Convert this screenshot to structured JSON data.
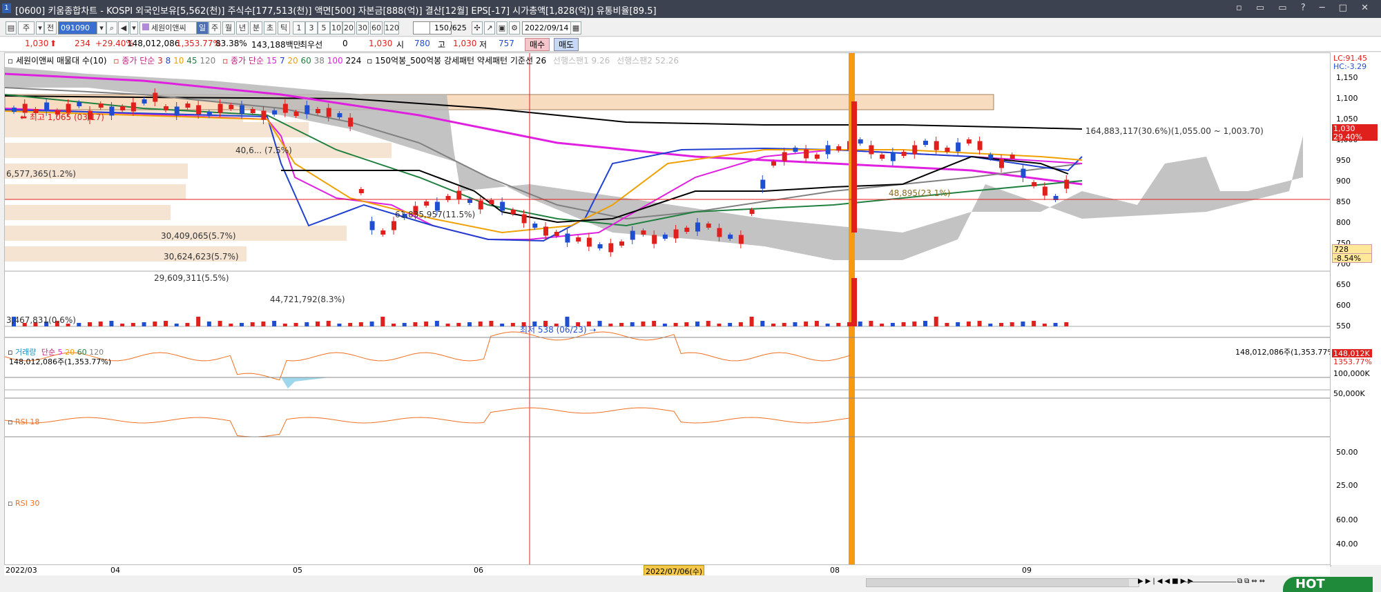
{
  "window": {
    "title": "[0600] 키움종합차트 - KOSPI 외국인보유[5,562(천)] 주식수[177,513(천)] 액면[500] 자본금[888(억)] 결산[12월] EPS[-17] 시가총액[1,828(억)] 유통비율[89.5]",
    "controls": [
      "minimize",
      "restore",
      "window",
      "help",
      "min",
      "max",
      "close"
    ]
  },
  "toolbar": {
    "period_ju": "주",
    "jeon": "전",
    "code": "091090",
    "stock_name": "세원이앤씨",
    "periods": [
      "일",
      "주",
      "월",
      "년",
      "분",
      "초",
      "틱"
    ],
    "active_period": "일",
    "intervals": [
      "1",
      "3",
      "5",
      "10",
      "20",
      "30",
      "60",
      "120"
    ],
    "count": "150",
    "total": "/625",
    "date": "2022/09/14"
  },
  "price_bar": {
    "price": "1,030",
    "change": "234",
    "change_pct": "+29.40%",
    "volume": "148,012,086",
    "vol_pct": "1,353.77%",
    "ratio": "83.38%",
    "amount": "143,188백만",
    "pref_label": "최우선",
    "pref_value": "0",
    "cur": "1,030",
    "open_label": "시",
    "open": "780",
    "high_label": "고",
    "high": "1,030",
    "low_label": "저",
    "low": "757",
    "buy": "매수",
    "sell": "매도"
  },
  "legend_price": {
    "name": "세원이앤씨 매물대 수(10)",
    "ma_label": "종가 단순",
    "ma_periods": [
      "3",
      "8",
      "10",
      "45",
      "120"
    ],
    "ma2_label": "종가 단순",
    "ma2_periods": [
      "15",
      "7",
      "20",
      "60",
      "38",
      "100",
      "224"
    ],
    "pattern": "150억봉_500억봉 강세패턴  약세패턴  기준선 26",
    "span1": "선행스팬1 9.26",
    "span2": "선행스팬2 52.26"
  },
  "annotations": {
    "high_marker": "최고 1,065 (03/17)",
    "low_marker": "최저 538 (06/23)",
    "vp": [
      "164,883,117(30.6%)(1,055.00 ~ 1,003.70)",
      "6,577,365(1.2%)",
      "40,6... (7.5%)",
      "61,835,957(11.5%)",
      "30,409,065(5.7%)",
      "30,624,623(5.7%)",
      "29,609,311(5.5%)",
      "44,721,792(8.3%)",
      "3,467,831(0.6%)",
      "48,895(23.1%)"
    ]
  },
  "y_axis": {
    "price_ticks": [
      "1,150",
      "1,100",
      "1,050",
      "1,000",
      "950",
      "900",
      "850",
      "800",
      "750",
      "700",
      "650",
      "600",
      "550"
    ],
    "lc": "LC:91.45",
    "hc": "HC:-3.29",
    "cur_label": "1,030",
    "cur_pct": "29.40%",
    "cross_label": "728",
    "cross_pct": "-8.54%",
    "vol_ticks": [
      "100,000K",
      "50,000K"
    ],
    "vol_label": "148,012K",
    "vol_pct": "1353.77%",
    "rsi18_ticks": [
      "50.00",
      "25.00"
    ],
    "rsi30_ticks": [
      "60.00",
      "40.00"
    ]
  },
  "volume_legend": {
    "label": "거래량",
    "ma_label": "단순",
    "periods": [
      "5",
      "20",
      "60",
      "120"
    ],
    "current": "148,012,086주(1,353.77%)",
    "right_label": "148,012,086주(1,353.77%)"
  },
  "rsi18": {
    "label": "RSI 18"
  },
  "rsi30": {
    "label": "RSI 30"
  },
  "x_axis": {
    "labels": [
      "2022/03",
      "04",
      "05",
      "06",
      "2022/07/06(수)",
      "08",
      "09"
    ]
  },
  "hot_badge": "HOT",
  "colors": {
    "up": "#e0201c",
    "down": "#1f4fd1",
    "ma_magenta": "#e020e0",
    "orange_bar": "#f59a12",
    "cloud": "#b8b8b8",
    "vp_fill": "#f5e4d2",
    "rsi_line": "#f07020"
  }
}
